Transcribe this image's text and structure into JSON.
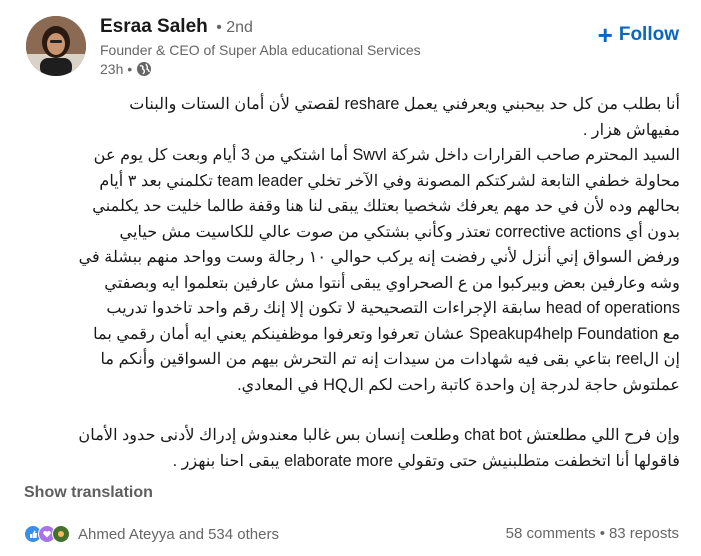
{
  "author": {
    "name": "Esraa Saleh",
    "degree": "• 2nd",
    "headline": "Founder & CEO of Super Abla educational Services",
    "time": "23h •"
  },
  "follow_label": "Follow",
  "post": {
    "lines": [
      "أنا بطلب من كل حد بيحبني ويعرفني يعمل reshare لقصتي لأن أمان الستات والبنات",
      "مفيهاش هزار .",
      "السيد المحترم صاحب القرارات داخل شركة Swvl أما اشتكي من 3 أيام وبعت كل يوم عن",
      "محاولة خطفي التابعة لشركتكم المصونة وفي الآخر تخلي team leader تكلمني بعد ٣ أيام",
      "بحالهم وده لأن في حد مهم يعرفك شخصيا بعتلك يبقى لنا هنا وقفة طالما خليت حد يكلمني",
      "بدون أي corrective actions تعتذر وكأني بشتكي من صوت عالي للكاسيت مش حيايي",
      "ورفض السواق إني أنزل لأني رفضت إنه يركب حوالي ١٠ رجالة وست وواحد منهم ببشلة في",
      "وشه وعارفين بعض وبيركبوا من ع الصحراوي يبقى أنتوا مش عارفين بتعلموا ايه وبصفتي",
      "head of operations سابقة الإجراءات التصحيحية لا تكون إلا إنك رقم واحد تاخدوا تدريب",
      "مع Speakup4help Foundation عشان تعرفوا وتعرفوا موظفينكم يعني ايه أمان رقمي بما",
      "إن الreel بتاعي بقى فيه شهادات من سيدات إنه تم التحرش بيهم من السواقين وأنكم ما",
      "عملتوش حاجة لدرجة إن واحدة كاتبة راحت لكم الHQ في المعادي.",
      "وإن فرح اللي مطلعتش chat bot وطلعت إنسان بس غالبا معندوش إدراك لأدنى حدود الأمان",
      "فاقولها أنا اتخطفت متطلبنيش حتى وتقولي elaborate more يبقى احنا بنهزر ."
    ]
  },
  "show_translation": "Show translation",
  "social": {
    "reactors": "Ahmed Ateyya and 534 others",
    "comments": "58 comments",
    "separator": "•",
    "reposts": "83 reposts"
  },
  "colors": {
    "accent": "#0a66c2",
    "muted": "#666666",
    "text": "#191919"
  },
  "icons": [
    "globe-icon",
    "plus-icon",
    "like-reaction-icon",
    "support-reaction-icon",
    "celebrate-reaction-icon"
  ]
}
